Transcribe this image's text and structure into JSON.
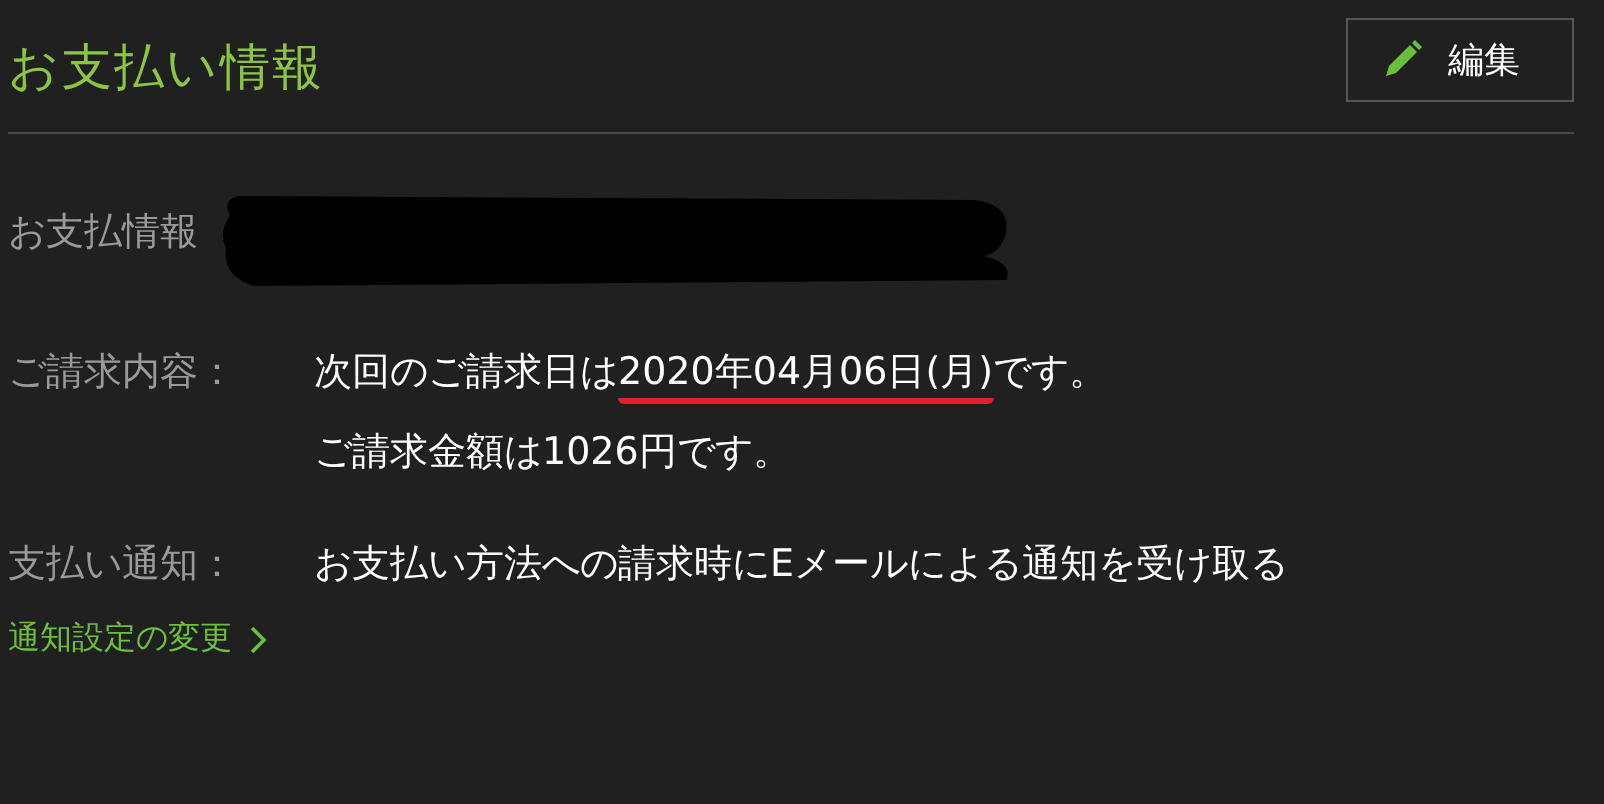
{
  "header": {
    "title": "お支払い情報",
    "edit_button": "編集"
  },
  "payment_info": {
    "label": "お支払情報",
    "redacted": true
  },
  "billing": {
    "label": "ご請求内容：",
    "next_date": {
      "prefix": "次回のご請求日は",
      "date": "2020年04月06日(月)",
      "suffix": "です。",
      "underlined": true
    },
    "amount": "ご請求金額は1026円です。"
  },
  "notification": {
    "label": "支払い通知：",
    "value": "お支払い方法への請求時にEメールによる通知を受け取る"
  },
  "settings_link": "通知設定の変更"
}
